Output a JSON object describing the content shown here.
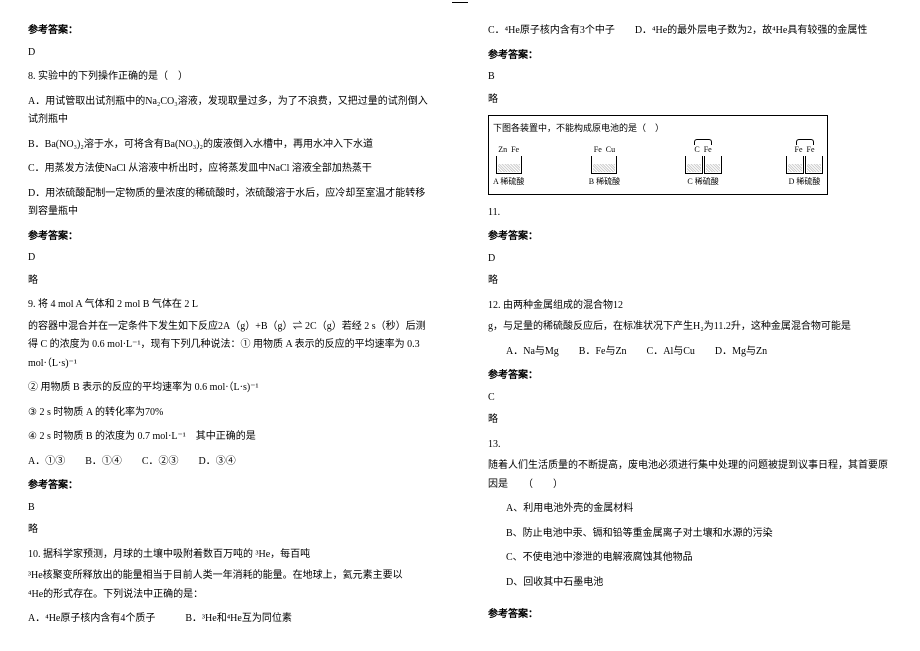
{
  "left": {
    "ans_hdr": "参考答案：",
    "ans7": "D",
    "q8_stem": "8. 实验中的下列操作正确的是（　）",
    "q8_A": "A．用试管取出试剂瓶中的Na₂CO₃溶液，发现取量过多，为了不浪费，又把过量的试剂倒入试剂瓶中",
    "q8_B": "B．Ba(NO₃)₂溶于水，可将含有Ba(NO₃)₂的废液倒入水槽中，再用水冲入下水道",
    "q8_C": "C．用蒸发方法使NaCl 从溶液中析出时，应将蒸发皿中NaCl 溶液全部加热蒸干",
    "q8_D": "D．用浓硫酸配制一定物质的量浓度的稀硫酸时，浓硫酸溶于水后，应冷却至室温才能转移到容量瓶中",
    "ans8": "D",
    "ans8_extra": "略",
    "q9_stem": "9. 将 4 mol A 气体和 2 mol B 气体在 2 L",
    "q9_cont": "的容器中混合并在一定条件下发生如下反应2A（g）+B（g）⇌ 2C（g）若经 2 s（秒）后测得 C 的浓度为 0.6 mol·L⁻¹，现有下列几种说法：① 用物质 A 表示的反应的平均速率为 0.3 mol·（L·s)⁻¹",
    "q9_2": "② 用物质 B 表示的反应的平均速率为 0.6 mol·（L·s)⁻¹",
    "q9_3": "③ 2 s 时物质 A 的转化率为70%",
    "q9_4": "④ 2 s 时物质 B 的浓度为 0.7 mol·L⁻¹　其中正确的是",
    "q9_opts": "A．①③　　B．①④　　C．②③　　D．③④",
    "ans9": "B",
    "ans9_extra": "略",
    "q10_stem": "10. 据科学家预测，月球的土壤中吸附着数百万吨的 ³He，每百吨",
    "q10_cont1": "³He核聚变所释放出的能量相当于目前人类一年消耗的能量。在地球上，氦元素主要以",
    "q10_cont2": "⁴He的形式存在。下列说法中正确的是：",
    "q10_AB": "A．⁴He原子核内含有4个质子　　　B．³He和⁴He互为同位素"
  },
  "right": {
    "q10_CD": "C．⁴He原子核内含有3个中子　　D．⁴He的最外层电子数为2，故⁴He具有较强的金属性",
    "ans_hdr": "参考答案：",
    "ans10": "B",
    "ans10_extra": "略",
    "diagram_caption": "下图各装置中，不能构成原电池的是（　）",
    "cells": {
      "A": {
        "left": "Zn",
        "right": "Fe",
        "label": "稀硫酸",
        "letter": "A"
      },
      "B": {
        "left": "Fe",
        "right": "Cu",
        "label": "稀硫酸",
        "letter": "B"
      },
      "C": {
        "left": "C",
        "right": "Fe",
        "label": "稀硫酸",
        "letter": "C"
      },
      "D": {
        "left": "Fe",
        "right": "Fe",
        "label": "稀硫酸",
        "letter": "D"
      }
    },
    "q11_num": "11.",
    "ans11": "D",
    "ans11_extra": "略",
    "q12_stem": "12. 由两种金属组成的混合物12",
    "q12_cont": "g，与足量的稀硫酸反应后，在标准状况下产生H₂为11.2升，这种金属混合物可能是",
    "q12_opts": "A．Na与Mg　　B．Fe与Zn　　C．Al与Cu　　D．Mg与Zn",
    "ans12": "C",
    "ans12_extra": "略",
    "q13_num": "13.",
    "q13_stem": "随着人们生活质量的不断提高，废电池必须进行集中处理的问题被提到议事日程，其首要原因是　　（　　）",
    "q13_A": "A、利用电池外壳的金属材料",
    "q13_B": "B、防止电池中汞、镉和铅等重金属离子对土壤和水源的污染",
    "q13_C": "C、不使电池中渗泄的电解液腐蚀其他物品",
    "q13_D": "D、回收其中石墨电池",
    "ans_hdr2": "参考答案："
  }
}
